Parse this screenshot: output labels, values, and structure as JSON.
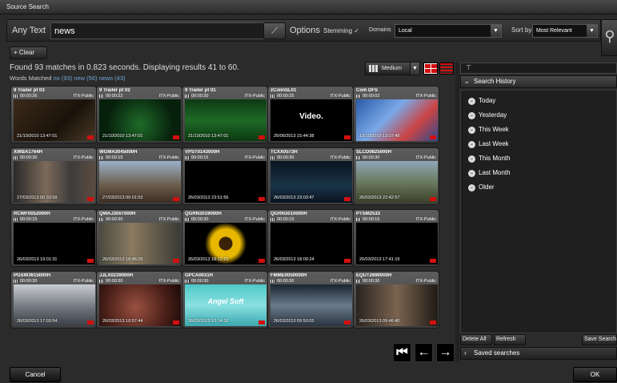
{
  "window": {
    "title": "Source Search"
  },
  "search": {
    "any_text_label": "Any Text",
    "query": "news",
    "options_label": "Options",
    "stemming_label": "Stemming",
    "stemming_check": "✓",
    "domains_label": "Domains",
    "domain_value": "Local",
    "sort_label": "Sort by",
    "sort_value": "Most Relevant"
  },
  "toolbar": {
    "clear_label": "Clear",
    "clear_icon": "+"
  },
  "results": {
    "found_text": "Found 93 matches in 0.823 seconds. Displaying results 41 to 60.",
    "words_label": "Words Matched",
    "words": "no (93) new (56) news (43)",
    "size_label": "Medium"
  },
  "thumbnails": [
    {
      "name": "9 Trailer pt 03",
      "duration": "00:00:26",
      "visibility": "ITX-Public",
      "timestamp": "21/10/2010 13:47:01",
      "scene": "dark-brown"
    },
    {
      "name": "9 Trailer pt 02",
      "duration": "00:00:22",
      "visibility": "ITX-Public",
      "timestamp": "21/10/2010 13:47:01",
      "scene": "green-text"
    },
    {
      "name": "9 Trailer pt 01",
      "duration": "00:00:30",
      "visibility": "ITX-Public",
      "timestamp": "21/10/2010 13:47:01",
      "scene": "green-rating"
    },
    {
      "name": "zColinSL01",
      "duration": "00:00:25",
      "visibility": "ITX-Public",
      "timestamp": "20/06/2013 15:44:38",
      "scene": "video-text",
      "caption": "Video."
    },
    {
      "name": "Com DFS",
      "duration": "00:00:02",
      "visibility": "ITX-Public",
      "timestamp": "19/10/2010 13:07:48",
      "scene": "dfs-logo"
    },
    {
      "name": "XWBA1764H",
      "duration": "00:00:30",
      "visibility": "ITX-Public",
      "timestamp": "27/03/2013 00:33:59",
      "scene": "people"
    },
    {
      "name": "WGMA3045000H",
      "duration": "00:00:15",
      "visibility": "ITX-Public",
      "timestamp": "27/03/2013 00:01:53",
      "scene": "group"
    },
    {
      "name": "VPST0143000H",
      "duration": "00:00:15",
      "visibility": "ITX-Public",
      "timestamp": "26/03/2013 23:51:56",
      "scene": "black"
    },
    {
      "name": "TCXX0573H",
      "duration": "00:00:30",
      "visibility": "ITX-Public",
      "timestamp": "26/03/2013 23:03:47",
      "scene": "dark-blue"
    },
    {
      "name": "SLCD0825000H",
      "duration": "00:00:30",
      "visibility": "ITX-Public",
      "timestamp": "26/03/2013 22:42:57",
      "scene": "landscape"
    },
    {
      "name": "RCWF0052000H",
      "duration": "00:00:15",
      "visibility": "ITX-Public",
      "timestamp": "26/03/2013 19:01:31",
      "scene": "black"
    },
    {
      "name": "QWAJ3007000H",
      "duration": "00:00:30",
      "visibility": "ITX-Public",
      "timestamp": "26/03/2013 18:46:29",
      "scene": "woman"
    },
    {
      "name": "QGRN3019000H",
      "duration": "00:00:30",
      "visibility": "ITX-Public",
      "timestamp": "26/03/2013 18:12:23",
      "scene": "sunflower"
    },
    {
      "name": "QGRN3010000H",
      "duration": "00:00:15",
      "visibility": "ITX-Public",
      "timestamp": "26/03/2013 18:09:24",
      "scene": "black"
    },
    {
      "name": "PTSM2533",
      "duration": "00:00:15",
      "visibility": "ITX-Public",
      "timestamp": "26/03/2013 17:41:19",
      "scene": "black"
    },
    {
      "name": "PGSW3615000H",
      "duration": "00:00:30",
      "visibility": "ITX-Public",
      "timestamp": "26/03/2013 17:03:54",
      "scene": "ward"
    },
    {
      "name": "JJLX0239000H",
      "duration": "00:00:30",
      "visibility": "ITX-Public",
      "timestamp": "26/03/2013 10:57:44",
      "scene": "face"
    },
    {
      "name": "GPCA0031H",
      "duration": "00:00:30",
      "visibility": "ITX-Public",
      "timestamp": "26/03/2013 10:14:18",
      "scene": "angel-soft",
      "caption": "Angel Soft"
    },
    {
      "name": "FMME0050000H",
      "duration": "00:00:30",
      "visibility": "ITX-Public",
      "timestamp": "26/03/2013 09:50:03",
      "scene": "tunnel"
    },
    {
      "name": "EQUT2690000H",
      "duration": "00:00:30",
      "visibility": "ITX-Public",
      "timestamp": "26/03/2013 09:46:40",
      "scene": "man"
    }
  ],
  "pager": {
    "first": "⏮",
    "prev": "←",
    "next": "→"
  },
  "history": {
    "title": "Search History",
    "items": [
      "Today",
      "Yesterday",
      "This Week",
      "Last Week",
      "This Month",
      "Last Month",
      "Older"
    ],
    "delete_all": "Delete All",
    "refresh": "Refresh",
    "save": "Save Search",
    "saved_title": "Saved searches"
  },
  "footer": {
    "cancel": "Cancel",
    "ok": "OK"
  }
}
